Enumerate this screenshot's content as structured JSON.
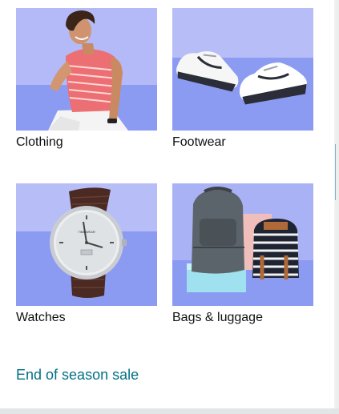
{
  "categories": [
    {
      "label": "Clothing",
      "image": "clothing-photo"
    },
    {
      "label": "Footwear",
      "image": "sneakers-photo"
    },
    {
      "label": "Watches",
      "image": "wristwatch-photo"
    },
    {
      "label": "Bags & luggage",
      "image": "backpacks-photo"
    }
  ],
  "footer_link": "End of season sale",
  "watch_brand": "TIMEWEAR",
  "colors": {
    "tile_background": "#8c9bf2",
    "tile_light_background": "#c6ccf6",
    "link": "#007185",
    "text": "#0f1111"
  }
}
